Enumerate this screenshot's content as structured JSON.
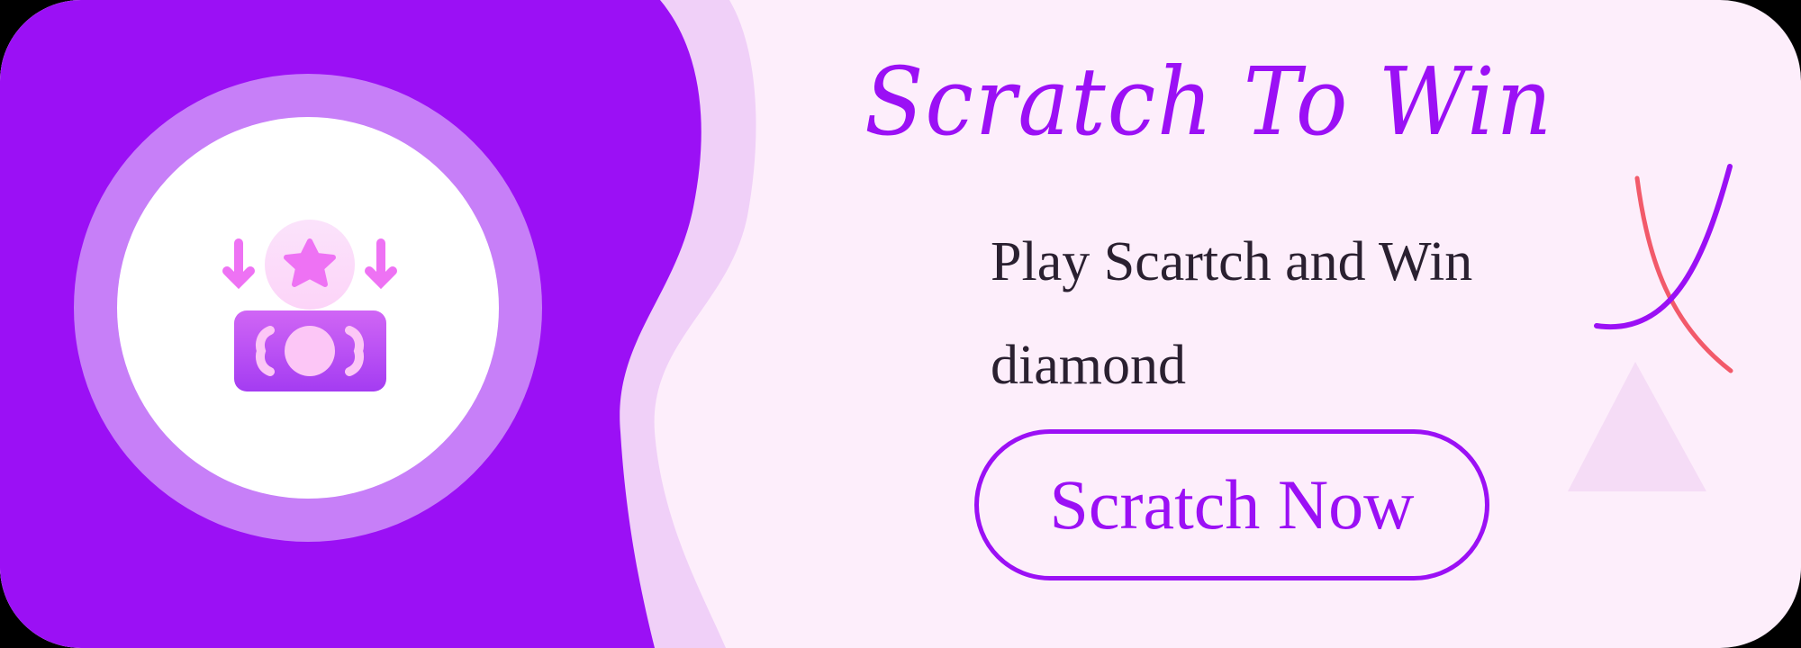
{
  "banner": {
    "title": "Scratch To Win",
    "subtitle_line1": "Play Scartch and Win",
    "subtitle_line2": "diamond",
    "cta_label": "Scratch Now"
  },
  "icons": [
    "scratch-card-star-icon"
  ],
  "colors": {
    "primary_purple": "#9b10f5",
    "light_background": "#fdeefb",
    "lavender_band": "#f0d0f8",
    "circle_ring": "#c77ff8",
    "accent_red": "#f25a6a",
    "text_dark": "#2a2030"
  }
}
